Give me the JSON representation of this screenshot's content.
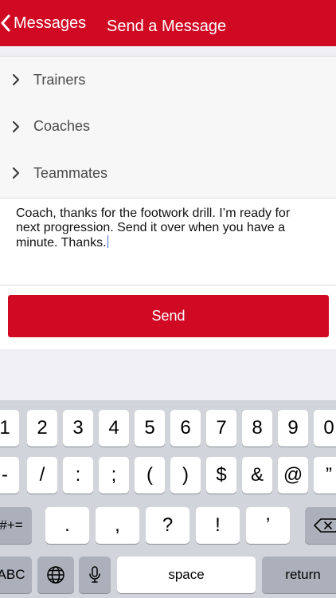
{
  "nav": {
    "back_label": "Messages",
    "title": "Send a Message"
  },
  "recipients": [
    {
      "label": "Trainers"
    },
    {
      "label": "Coaches"
    },
    {
      "label": "Teammates"
    }
  ],
  "message": {
    "lines": [
      "Coach, thanks for the footwork drill. I’m ready for",
      "next progression. Send it over when you have a",
      "minute. Thanks."
    ]
  },
  "send_label": "Send",
  "keyboard": {
    "row1": [
      "1",
      "2",
      "3",
      "4",
      "5",
      "6",
      "7",
      "8",
      "9",
      "0"
    ],
    "row2": [
      "-",
      "/",
      ":",
      ";",
      "(",
      ")",
      "$",
      "&",
      "@",
      "”"
    ],
    "row3_left": "#+=",
    "row3": [
      ".",
      ",",
      "?",
      "!",
      "’"
    ],
    "abc": "ABC",
    "space": "space",
    "return": "return"
  },
  "colors": {
    "brand_red": "#d10a24",
    "keyboard_bg": "#d1d4da"
  }
}
